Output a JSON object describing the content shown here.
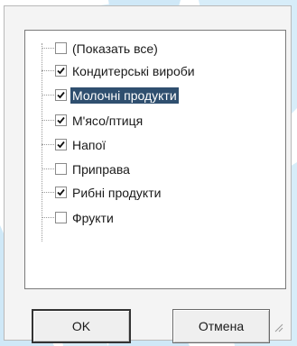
{
  "filter": {
    "items": [
      {
        "label": "(Показать все)",
        "checked": false,
        "selected": false
      },
      {
        "label": "Кондитерські вироби",
        "checked": true,
        "selected": false
      },
      {
        "label": "Молочні продукти",
        "checked": true,
        "selected": true
      },
      {
        "label": "М'ясо/птиця",
        "checked": true,
        "selected": false
      },
      {
        "label": "Напої",
        "checked": true,
        "selected": false
      },
      {
        "label": "Приправа",
        "checked": false,
        "selected": false
      },
      {
        "label": "Рибні продукти",
        "checked": true,
        "selected": false
      },
      {
        "label": "Фрукти",
        "checked": false,
        "selected": false
      }
    ]
  },
  "buttons": {
    "ok_label": "OK",
    "cancel_label": "Отмена"
  },
  "colors": {
    "selection": "#2f4f6f",
    "watermark": "#bfe1f5"
  }
}
